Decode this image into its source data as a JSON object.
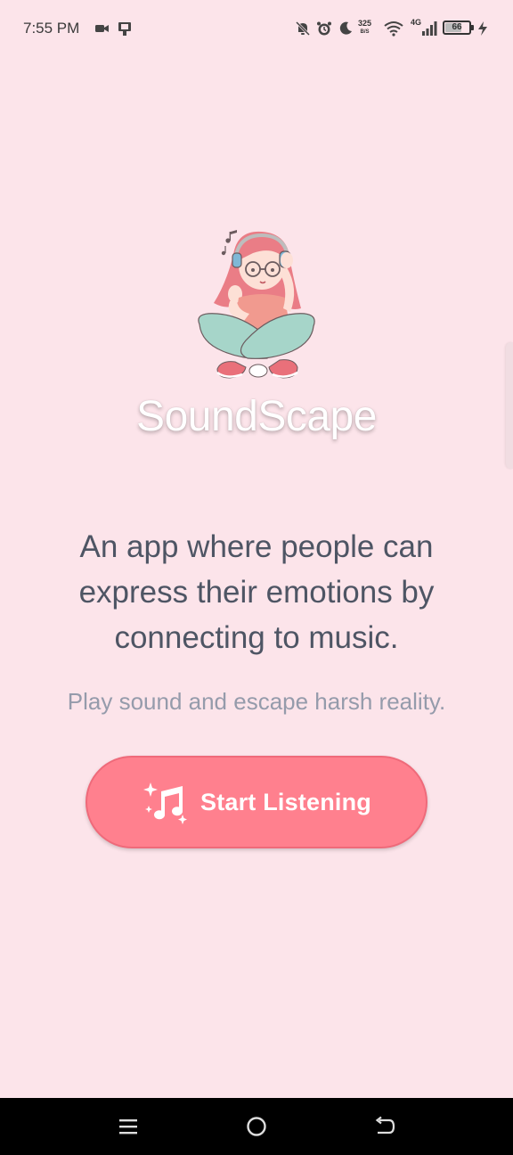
{
  "status_bar": {
    "time": "7:55 PM",
    "net_speed_value": "325",
    "net_speed_unit": "B/S",
    "network_generation": "4G",
    "battery_level": "66",
    "icons": [
      "video-camera-icon",
      "screen-icon",
      "mute-bell-icon",
      "alarm-icon",
      "moon-icon",
      "wifi-icon",
      "signal-icon",
      "battery-icon",
      "charging-bolt-icon"
    ]
  },
  "app": {
    "title": "SoundScape",
    "tagline": "An app where people can express their emotions by connecting to music.",
    "subtagline": "Play sound and escape harsh reality.",
    "start_button_label": "Start Listening",
    "start_button_icon": "music-notes-sparkle-icon",
    "accent_color": "#ff808e",
    "background_color": "#fce4ea"
  },
  "nav_bar": {
    "icons": [
      "menu-icon",
      "home-circle-icon",
      "back-icon"
    ]
  }
}
